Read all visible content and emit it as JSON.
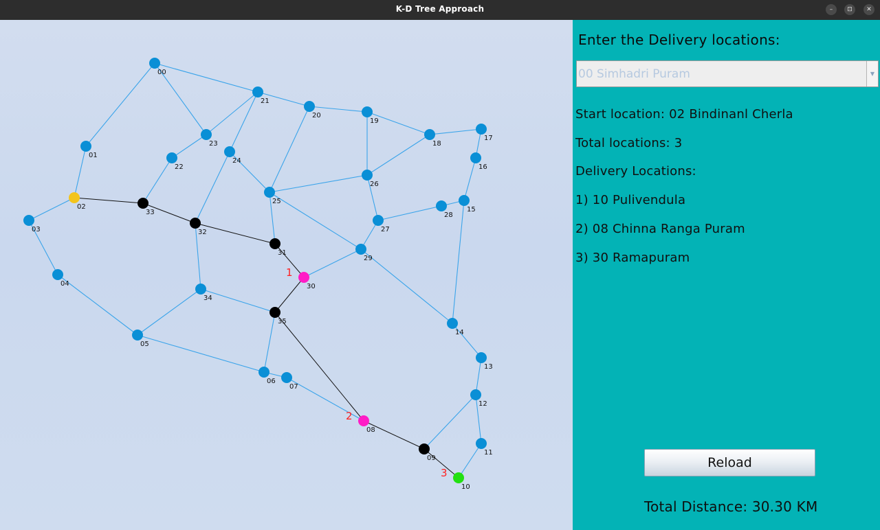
{
  "window": {
    "title": "K-D Tree Approach",
    "buttons": {
      "minimize": "–",
      "maximize": "⊡",
      "close": "✕"
    }
  },
  "panel": {
    "heading": "Enter the Delivery locations:",
    "location_select": {
      "selected": "00 Simhadri Puram"
    },
    "start_location": "Start location:  02 Bindinanl Cherla",
    "total_locations": "Total locations: 3",
    "delivery_header": "Delivery Locations:",
    "deliveries": [
      "1) 10 Pulivendula",
      "2) 08 Chinna Ranga Puram",
      "3) 30 Ramapuram"
    ],
    "reload_label": "Reload",
    "total_distance": "Total Distance: 30.30 KM"
  },
  "map": {
    "colors": {
      "node": "#0a8fd6",
      "edge": "#3aa4ea",
      "route_edge": "#111111",
      "route_node": "#000000",
      "start": "#f3c41b",
      "delivery": "#ff1cc6",
      "final": "#22e011",
      "order_label": "#ff2020"
    },
    "nodes": [
      {
        "id": "00",
        "type": "normal"
      },
      {
        "id": "01",
        "type": "normal"
      },
      {
        "id": "02",
        "type": "start"
      },
      {
        "id": "03",
        "type": "normal"
      },
      {
        "id": "04",
        "type": "normal"
      },
      {
        "id": "05",
        "type": "normal"
      },
      {
        "id": "06",
        "type": "normal"
      },
      {
        "id": "07",
        "type": "normal"
      },
      {
        "id": "08",
        "type": "delivery"
      },
      {
        "id": "09",
        "type": "route"
      },
      {
        "id": "10",
        "type": "final"
      },
      {
        "id": "11",
        "type": "normal"
      },
      {
        "id": "12",
        "type": "normal"
      },
      {
        "id": "13",
        "type": "normal"
      },
      {
        "id": "14",
        "type": "normal"
      },
      {
        "id": "15",
        "type": "normal"
      },
      {
        "id": "16",
        "type": "normal"
      },
      {
        "id": "17",
        "type": "normal"
      },
      {
        "id": "18",
        "type": "normal"
      },
      {
        "id": "19",
        "type": "normal"
      },
      {
        "id": "20",
        "type": "normal"
      },
      {
        "id": "21",
        "type": "normal"
      },
      {
        "id": "22",
        "type": "normal"
      },
      {
        "id": "23",
        "type": "normal"
      },
      {
        "id": "24",
        "type": "normal"
      },
      {
        "id": "25",
        "type": "normal"
      },
      {
        "id": "26",
        "type": "normal"
      },
      {
        "id": "27",
        "type": "normal"
      },
      {
        "id": "28",
        "type": "normal"
      },
      {
        "id": "29",
        "type": "normal"
      },
      {
        "id": "30",
        "type": "delivery"
      },
      {
        "id": "31",
        "type": "route"
      },
      {
        "id": "32",
        "type": "route"
      },
      {
        "id": "33",
        "type": "route"
      },
      {
        "id": "34",
        "type": "normal"
      },
      {
        "id": "35",
        "type": "route"
      }
    ],
    "edges": [
      [
        "00",
        "01"
      ],
      [
        "00",
        "21"
      ],
      [
        "00",
        "23"
      ],
      [
        "01",
        "02"
      ],
      [
        "02",
        "03"
      ],
      [
        "03",
        "04"
      ],
      [
        "04",
        "05"
      ],
      [
        "05",
        "06"
      ],
      [
        "05",
        "34"
      ],
      [
        "34",
        "32"
      ],
      [
        "34",
        "35"
      ],
      [
        "35",
        "06"
      ],
      [
        "06",
        "07"
      ],
      [
        "07",
        "08"
      ],
      [
        "09",
        "12"
      ],
      [
        "12",
        "11"
      ],
      [
        "12",
        "13"
      ],
      [
        "13",
        "14"
      ],
      [
        "14",
        "15"
      ],
      [
        "15",
        "16"
      ],
      [
        "16",
        "17"
      ],
      [
        "17",
        "18"
      ],
      [
        "15",
        "28"
      ],
      [
        "28",
        "27"
      ],
      [
        "27",
        "26"
      ],
      [
        "27",
        "29"
      ],
      [
        "29",
        "30"
      ],
      [
        "29",
        "14"
      ],
      [
        "29",
        "25"
      ],
      [
        "25",
        "26"
      ],
      [
        "26",
        "19"
      ],
      [
        "26",
        "18"
      ],
      [
        "19",
        "18"
      ],
      [
        "19",
        "20"
      ],
      [
        "20",
        "21"
      ],
      [
        "20",
        "25"
      ],
      [
        "21",
        "23"
      ],
      [
        "21",
        "24"
      ],
      [
        "23",
        "22"
      ],
      [
        "22",
        "33"
      ],
      [
        "24",
        "32"
      ],
      [
        "24",
        "25"
      ],
      [
        "25",
        "31"
      ],
      [
        "11",
        "10"
      ]
    ],
    "route": [
      "02",
      "33",
      "32",
      "31",
      "30",
      "35",
      "08",
      "09",
      "10"
    ],
    "order_labels": [
      {
        "node": "30",
        "text": "1"
      },
      {
        "node": "08",
        "text": "2"
      },
      {
        "node": "10",
        "text": "3"
      }
    ]
  }
}
